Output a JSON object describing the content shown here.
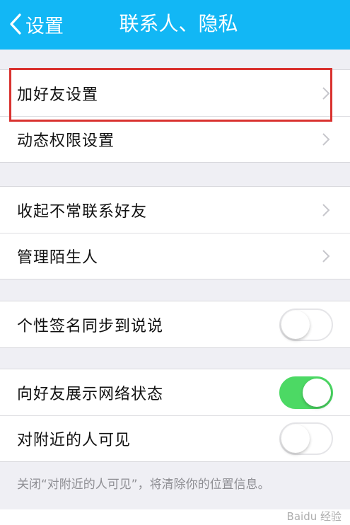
{
  "nav": {
    "back_label": "设置",
    "title": "联系人、隐私"
  },
  "groups": [
    {
      "rows": [
        {
          "label": "加好友设置",
          "accessory": "chevron"
        },
        {
          "label": "动态权限设置",
          "accessory": "chevron"
        }
      ]
    },
    {
      "rows": [
        {
          "label": "收起不常联系好友",
          "accessory": "chevron"
        },
        {
          "label": "管理陌生人",
          "accessory": "chevron"
        }
      ]
    },
    {
      "rows": [
        {
          "label": "个性签名同步到说说",
          "accessory": "toggle",
          "on": false
        }
      ]
    },
    {
      "rows": [
        {
          "label": "向好友展示网络状态",
          "accessory": "toggle",
          "on": true
        },
        {
          "label": "对附近的人可见",
          "accessory": "toggle",
          "on": false
        }
      ]
    }
  ],
  "footnote": "关闭“对附近的人可见”，将清除你的位置信息。",
  "watermark": "Baidu 经验",
  "colors": {
    "nav_bg": "#12b7f5",
    "toggle_on": "#4cd964",
    "highlight": "#d9322f"
  }
}
